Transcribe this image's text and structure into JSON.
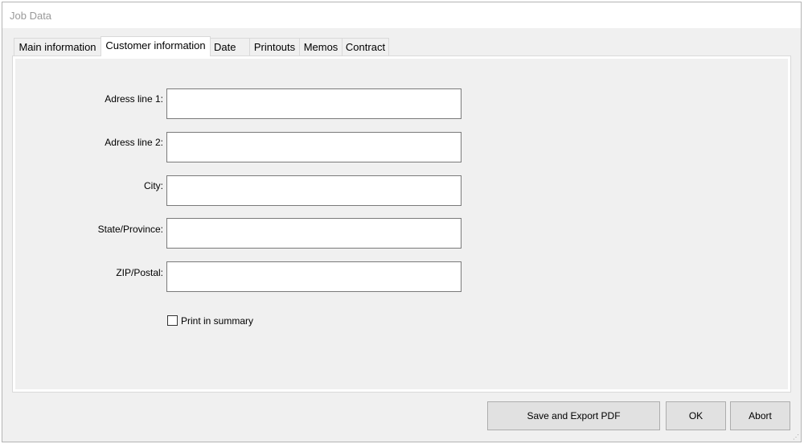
{
  "window": {
    "title": "Job Data"
  },
  "tabs": [
    {
      "label": "Main information"
    },
    {
      "label": "Customer information",
      "active": true
    },
    {
      "label": "Date"
    },
    {
      "label": "Printouts"
    },
    {
      "label": "Memos"
    },
    {
      "label": "Contract"
    }
  ],
  "form": {
    "address1": {
      "label": "Adress line 1:",
      "value": ""
    },
    "address2": {
      "label": "Adress line 2:",
      "value": ""
    },
    "city": {
      "label": "City:",
      "value": ""
    },
    "state": {
      "label": "State/Province:",
      "value": ""
    },
    "zip": {
      "label": "ZIP/Postal:",
      "value": ""
    },
    "print_summary": {
      "label": "Print in summary",
      "checked": false
    }
  },
  "buttons": {
    "save_export": "Save and Export PDF",
    "ok": "OK",
    "abort": "Abort"
  }
}
